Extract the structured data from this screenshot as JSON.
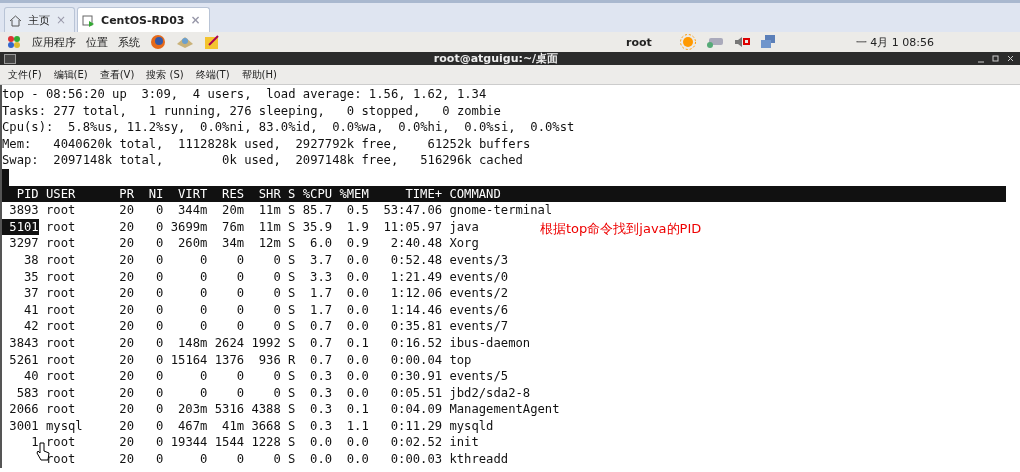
{
  "tabs": [
    {
      "label": "主页",
      "selected": false,
      "close": "×"
    },
    {
      "label": "CentOS-RD03",
      "selected": true,
      "close": "×"
    }
  ],
  "panel": {
    "menus": [
      "应用程序",
      "位置",
      "系统"
    ],
    "user": "root",
    "clock": "一 4月  1 08:56"
  },
  "terminal": {
    "title": "root@atguigu:~/桌面",
    "menu": [
      "文件(F)",
      "编辑(E)",
      "查看(V)",
      "搜索 (S)",
      "终端(T)",
      "帮助(H)"
    ],
    "summary": [
      "top - 08:56:20 up  3:09,  4 users,  load average: 1.56, 1.62, 1.34",
      "Tasks: 277 total,   1 running, 276 sleeping,   0 stopped,   0 zombie",
      "Cpu(s):  5.8%us, 11.2%sy,  0.0%ni, 83.0%id,  0.0%wa,  0.0%hi,  0.0%si,  0.0%st",
      "Mem:   4040620k total,  1112828k used,  2927792k free,    61252k buffers",
      "Swap:  2097148k total,        0k used,  2097148k free,   516296k cached"
    ],
    "columns": [
      "PID",
      "USER",
      "PR",
      "NI",
      "VIRT",
      "RES",
      "SHR",
      "S",
      "%CPU",
      "%MEM",
      "TIME+",
      "COMMAND"
    ],
    "rows": [
      {
        "selected": false,
        "cells": [
          "3893",
          "root",
          "20",
          "0",
          "344m",
          "20m",
          "11m",
          "S",
          "85.7",
          "0.5",
          "53:47.06",
          "gnome-terminal"
        ]
      },
      {
        "selected": true,
        "cells": [
          "5101",
          "root",
          "20",
          "0",
          "3699m",
          "76m",
          "11m",
          "S",
          "35.9",
          "1.9",
          "11:05.97",
          "java"
        ]
      },
      {
        "selected": false,
        "cells": [
          "3297",
          "root",
          "20",
          "0",
          "260m",
          "34m",
          "12m",
          "S",
          "6.0",
          "0.9",
          "2:40.48",
          "Xorg"
        ]
      },
      {
        "selected": false,
        "cells": [
          "38",
          "root",
          "20",
          "0",
          "0",
          "0",
          "0",
          "S",
          "3.7",
          "0.0",
          "0:52.48",
          "events/3"
        ]
      },
      {
        "selected": false,
        "cells": [
          "35",
          "root",
          "20",
          "0",
          "0",
          "0",
          "0",
          "S",
          "3.3",
          "0.0",
          "1:21.49",
          "events/0"
        ]
      },
      {
        "selected": false,
        "cells": [
          "37",
          "root",
          "20",
          "0",
          "0",
          "0",
          "0",
          "S",
          "1.7",
          "0.0",
          "1:12.06",
          "events/2"
        ]
      },
      {
        "selected": false,
        "cells": [
          "41",
          "root",
          "20",
          "0",
          "0",
          "0",
          "0",
          "S",
          "1.7",
          "0.0",
          "1:14.46",
          "events/6"
        ]
      },
      {
        "selected": false,
        "cells": [
          "42",
          "root",
          "20",
          "0",
          "0",
          "0",
          "0",
          "S",
          "0.7",
          "0.0",
          "0:35.81",
          "events/7"
        ]
      },
      {
        "selected": false,
        "cells": [
          "3843",
          "root",
          "20",
          "0",
          "148m",
          "2624",
          "1992",
          "S",
          "0.7",
          "0.1",
          "0:16.52",
          "ibus-daemon"
        ]
      },
      {
        "selected": false,
        "cells": [
          "5261",
          "root",
          "20",
          "0",
          "15164",
          "1376",
          "936",
          "R",
          "0.7",
          "0.0",
          "0:00.04",
          "top"
        ]
      },
      {
        "selected": false,
        "cells": [
          "40",
          "root",
          "20",
          "0",
          "0",
          "0",
          "0",
          "S",
          "0.3",
          "0.0",
          "0:30.91",
          "events/5"
        ]
      },
      {
        "selected": false,
        "cells": [
          "583",
          "root",
          "20",
          "0",
          "0",
          "0",
          "0",
          "S",
          "0.3",
          "0.0",
          "0:05.51",
          "jbd2/sda2-8"
        ]
      },
      {
        "selected": false,
        "cells": [
          "2066",
          "root",
          "20",
          "0",
          "203m",
          "5316",
          "4388",
          "S",
          "0.3",
          "0.1",
          "0:04.09",
          "ManagementAgent"
        ]
      },
      {
        "selected": false,
        "cells": [
          "3001",
          "mysql",
          "20",
          "0",
          "467m",
          "41m",
          "3668",
          "S",
          "0.3",
          "1.1",
          "0:11.29",
          "mysqld"
        ]
      },
      {
        "selected": false,
        "cells": [
          "1",
          "root",
          "20",
          "0",
          "19344",
          "1544",
          "1228",
          "S",
          "0.0",
          "0.0",
          "0:02.52",
          "init"
        ]
      },
      {
        "selected": false,
        "cells": [
          null,
          "root",
          "20",
          "0",
          "0",
          "0",
          "0",
          "S",
          "0.0",
          "0.0",
          "0:00.03",
          "kthreadd"
        ]
      }
    ],
    "annotation": "根据top命令找到java的PID"
  }
}
